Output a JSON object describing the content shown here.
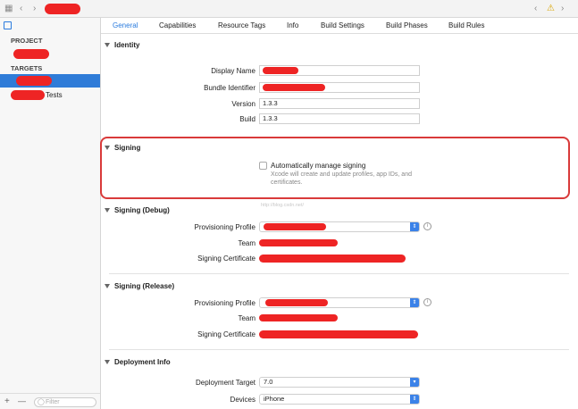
{
  "toolbar": {
    "grid_icon": "grid-icon",
    "back_icon": "chevron-left-icon",
    "forward_icon": "chevron-right-icon",
    "warning_icon": "warning-icon"
  },
  "sidebar": {
    "project_header": "PROJECT",
    "targets_header": "TARGETS",
    "tests_suffix": "Tests",
    "filter_placeholder": "Filter",
    "add_label": "+",
    "remove_label": "—"
  },
  "tabs": [
    "General",
    "Capabilities",
    "Resource Tags",
    "Info",
    "Build Settings",
    "Build Phases",
    "Build Rules"
  ],
  "identity": {
    "title": "Identity",
    "display_name_label": "Display Name",
    "bundle_id_label": "Bundle Identifier",
    "version_label": "Version",
    "version_value": "1.3.3",
    "build_label": "Build",
    "build_value": "1.3.3"
  },
  "signing": {
    "title": "Signing",
    "auto_label": "Automatically manage signing",
    "auto_desc_1": "Xcode will create and update profiles, app IDs, and",
    "auto_desc_2": "certificates."
  },
  "signing_debug": {
    "title": "Signing (Debug)",
    "profile_label": "Provisioning Profile",
    "team_label": "Team",
    "cert_label": "Signing Certificate"
  },
  "signing_release": {
    "title": "Signing (Release)",
    "profile_label": "Provisioning Profile",
    "team_label": "Team",
    "cert_label": "Signing Certificate"
  },
  "deployment": {
    "title": "Deployment Info",
    "target_label": "Deployment Target",
    "target_value": "7.0",
    "devices_label": "Devices",
    "devices_value": "iPhone"
  },
  "watermark": "http://blog.csdn.net/",
  "accent_color": "#2a7bde",
  "highlight_color": "#d93a3a"
}
